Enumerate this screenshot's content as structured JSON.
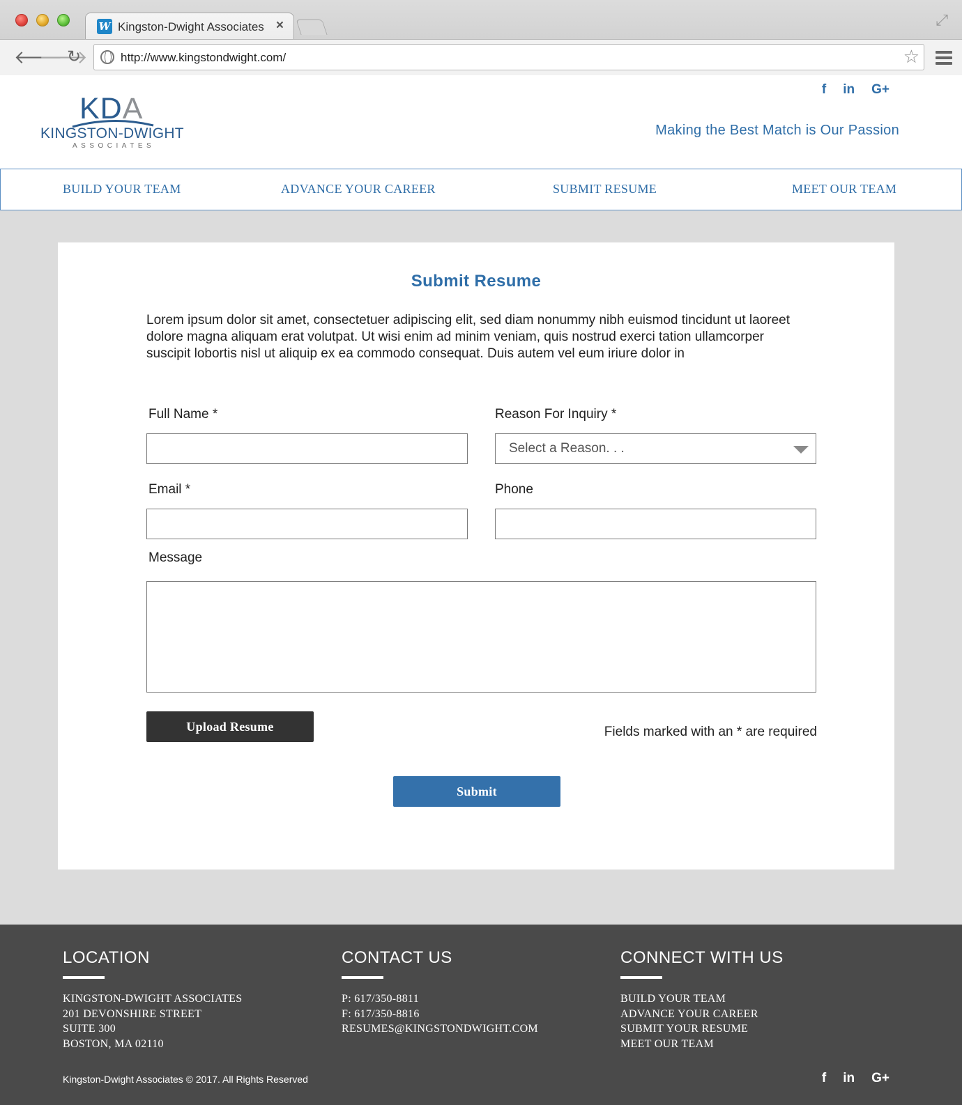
{
  "browser": {
    "tab_title": "Kingston-Dwight Associates",
    "favicon_letter": "W",
    "url": "http://www.kingstondwight.com/"
  },
  "header": {
    "logo": {
      "mark_main": "KD",
      "mark_accent": "A",
      "name": "KINGSTON-DWIGHT",
      "sub": "ASSOCIATES"
    },
    "social": [
      "f",
      "in",
      "G+"
    ],
    "tagline": "Making the Best Match is Our Passion"
  },
  "nav": {
    "items": [
      "BUILD YOUR TEAM",
      "ADVANCE YOUR CAREER",
      "SUBMIT RESUME",
      "MEET OUR TEAM"
    ]
  },
  "form": {
    "title": "Submit Resume",
    "intro": "Lorem ipsum dolor sit amet, consectetuer adipiscing elit, sed diam nonummy nibh euismod tincidunt ut laoreet dolore magna aliquam erat volutpat. Ut wisi enim ad minim veniam, quis nostrud exerci tation ullamcorper suscipit lobortis nisl ut aliquip ex ea commodo consequat. Duis autem vel eum iriure dolor in",
    "full_name_label": "Full Name *",
    "full_name_value": "",
    "reason_label": "Reason For Inquiry *",
    "reason_value": "Select a Reason. . .",
    "email_label": "Email *",
    "email_value": "",
    "phone_label": "Phone",
    "phone_value": "",
    "message_label": "Message",
    "message_value": "",
    "upload_label": "Upload Resume",
    "required_note": "Fields marked with an * are required",
    "submit_label": "Submit"
  },
  "footer": {
    "location": {
      "heading": "LOCATION",
      "lines": [
        "KINGSTON-DWIGHT ASSOCIATES",
        "201 DEVONSHIRE STREET",
        "SUITE 300",
        "BOSTON, MA 02110"
      ]
    },
    "contact": {
      "heading": "CONTACT US",
      "lines": [
        "P: 617/350-8811",
        "F: 617/350-8816",
        "RESUMES@KINGSTONDWIGHT.COM"
      ]
    },
    "connect": {
      "heading": "CONNECT WITH US",
      "links": [
        "BUILD YOUR TEAM",
        "ADVANCE YOUR CAREER",
        "SUBMIT YOUR RESUME",
        "MEET OUR TEAM"
      ]
    },
    "copyright": "Kingston-Dwight Associates © 2017. All Rights Reserved",
    "social": [
      "f",
      "in",
      "G+"
    ]
  },
  "colors": {
    "brand_blue": "#2f6ea8",
    "submit_blue": "#3471ab",
    "upload_dark": "#333333",
    "page_gray": "#dcdcdc",
    "footer_gray": "#4a4a4a"
  }
}
